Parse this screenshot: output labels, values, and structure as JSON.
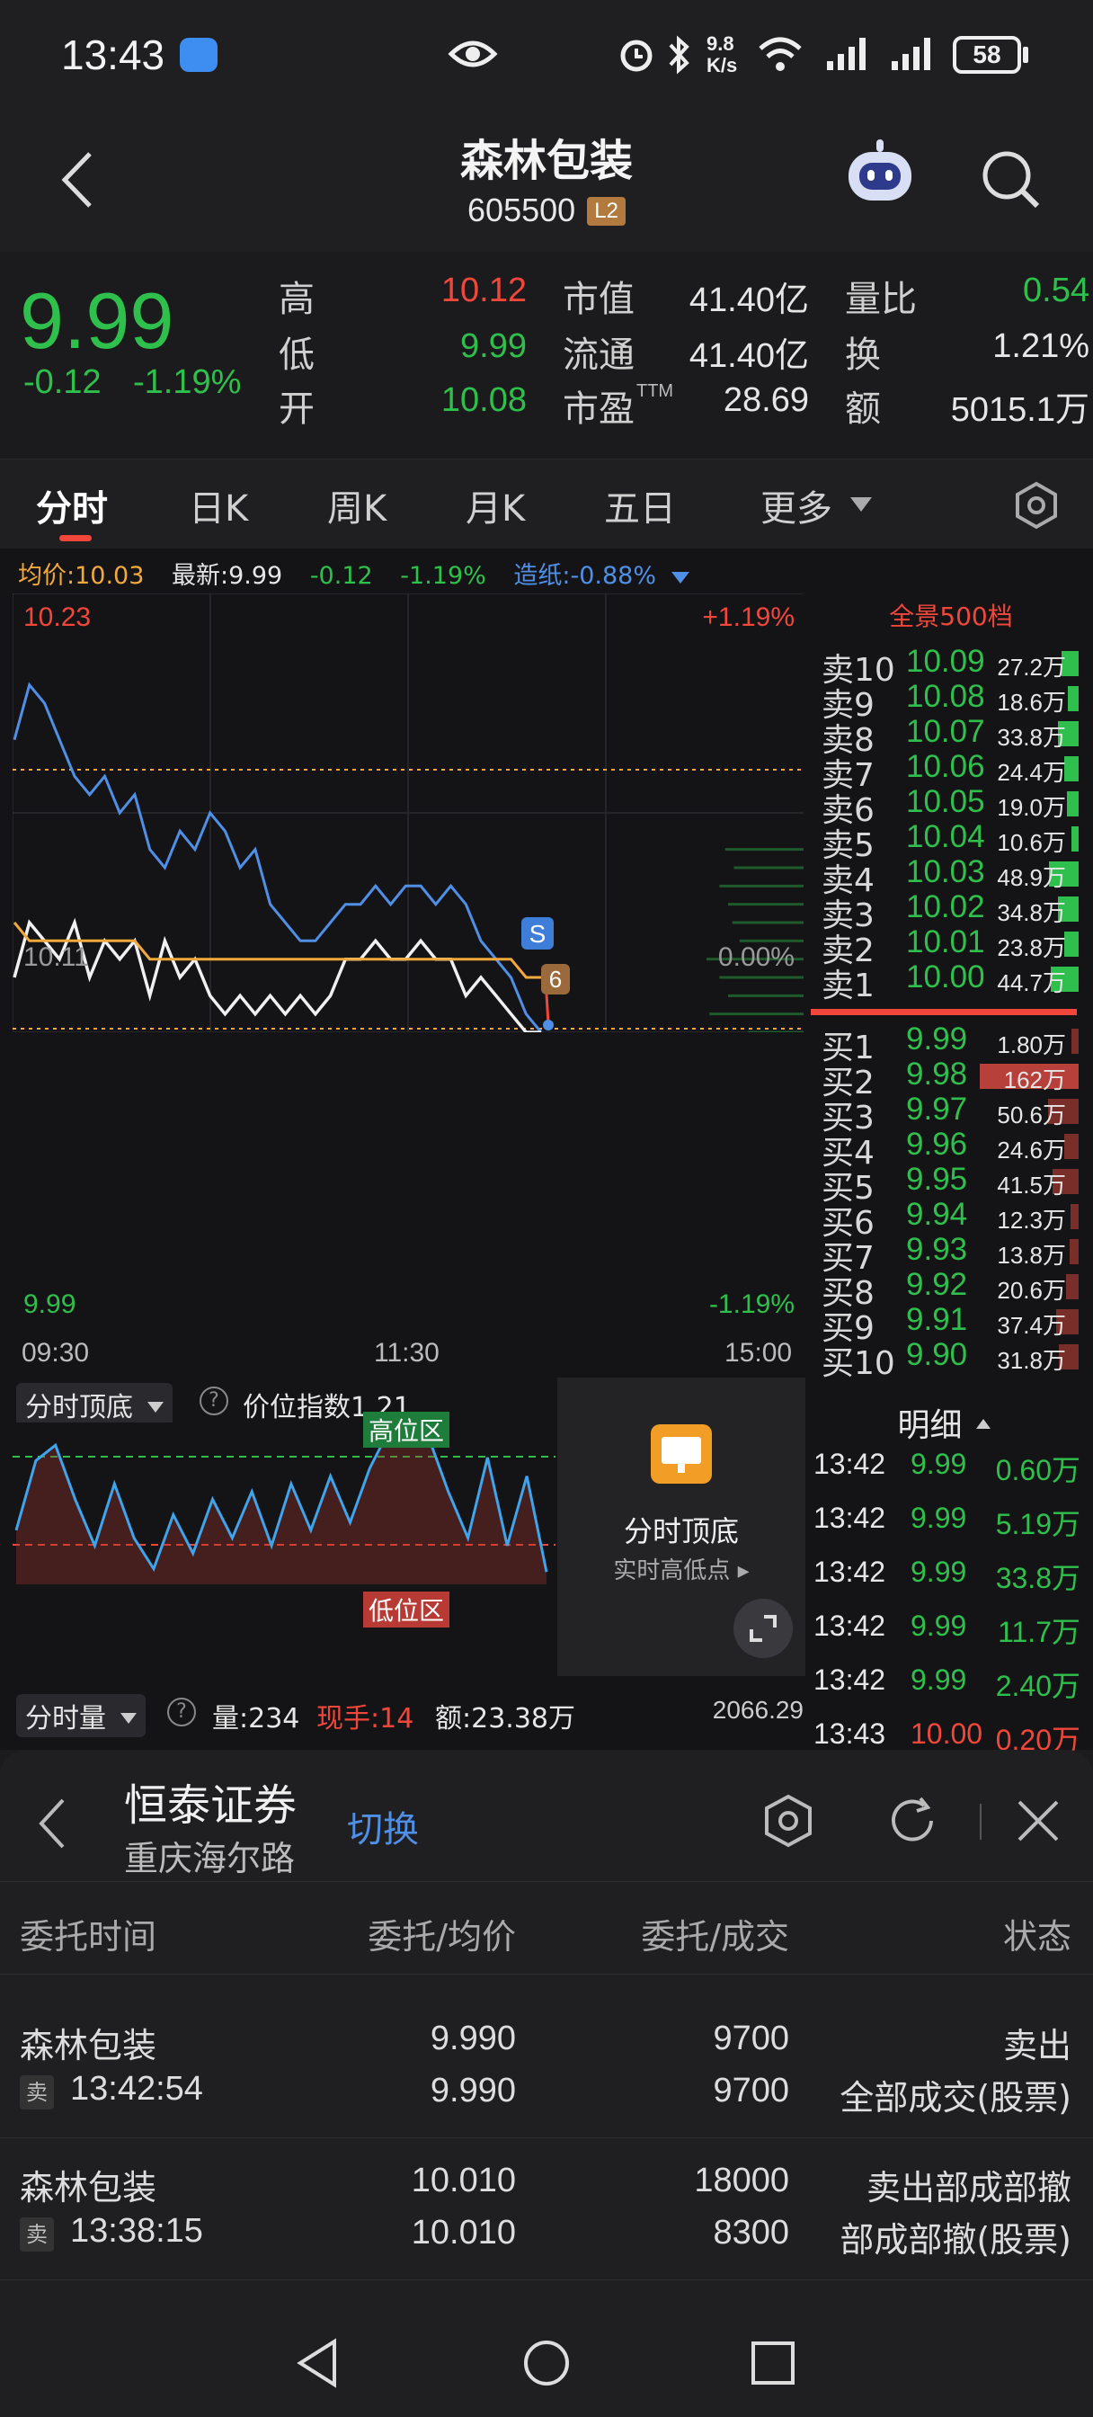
{
  "status": {
    "time": "13:43",
    "net_speed_top": "9.8",
    "net_speed_bottom": "K/s",
    "battery": "58"
  },
  "nav": {
    "title": "森林包装",
    "code": "605500",
    "badge": "L2"
  },
  "quote": {
    "price": "9.99",
    "change": "-0.12",
    "change_pct": "-1.19%",
    "high_label": "高",
    "high": "10.12",
    "low_label": "低",
    "low": "9.99",
    "open_label": "开",
    "open": "10.08",
    "mcap_label": "市值",
    "mcap": "41.40亿",
    "float_label": "流通",
    "float": "41.40亿",
    "pe_label": "市盈",
    "pe_sup": "TTM",
    "pe": "28.69",
    "vr_label": "量比",
    "vr": "0.54",
    "turn_label": "换",
    "turn": "1.21%",
    "amt_label": "额",
    "amt": "5015.1万"
  },
  "tabs": [
    "分时",
    "日K",
    "周K",
    "月K",
    "五日",
    "更多"
  ],
  "chart_info": {
    "avg_label": "均价:10.03",
    "last_label": "最新:9.99",
    "chg": "-0.12",
    "chg_pct": "-1.19%",
    "paper": "造纸:-0.88%"
  },
  "chart_data": {
    "type": "line",
    "y_top": "10.23",
    "y_mid": "10.11",
    "y_bottom": "9.99",
    "pct_top": "+1.19%",
    "pct_mid": "0.00%",
    "pct_bottom": "-1.19%",
    "x_labels": [
      "09:30",
      "11:30",
      "15:00"
    ],
    "ylim": [
      9.99,
      10.23
    ],
    "series": [
      {
        "values": [
          10.15,
          10.18,
          10.17,
          10.15,
          10.13,
          10.12,
          10.13,
          10.11,
          10.12,
          10.09,
          10.08,
          10.1,
          10.09,
          10.11,
          10.1,
          10.08,
          10.09,
          10.06,
          10.05,
          10.04,
          10.04,
          10.05,
          10.06,
          10.06,
          10.07,
          10.06,
          10.07,
          10.07,
          10.06,
          10.07,
          10.06,
          10.04,
          10.03,
          10.02,
          10.0,
          9.99
        ]
      },
      {
        "values": [
          10.02,
          10.05,
          10.04,
          10.03,
          10.05,
          10.02,
          10.04,
          10.03,
          10.04,
          10.01,
          10.04,
          10.02,
          10.03,
          10.01,
          10.0,
          10.01,
          10.0,
          10.01,
          10.0,
          10.01,
          10.0,
          10.01,
          10.03,
          10.03,
          10.04,
          10.03,
          10.03,
          10.04,
          10.03,
          10.03,
          10.01,
          10.02,
          10.01,
          10.0,
          9.99,
          9.99
        ]
      },
      {
        "values": [
          10.05,
          10.04,
          10.04,
          10.04,
          10.04,
          10.04,
          10.04,
          10.04,
          10.04,
          10.03,
          10.03,
          10.03,
          10.03,
          10.03,
          10.03,
          10.03,
          10.03,
          10.03,
          10.03,
          10.03,
          10.03,
          10.03,
          10.03,
          10.03,
          10.03,
          10.03,
          10.03,
          10.03,
          10.03,
          10.03,
          10.03,
          10.03,
          10.03,
          10.03,
          10.02,
          10.02
        ]
      }
    ],
    "markers": {
      "s": "S",
      "b": "6"
    }
  },
  "indicator": {
    "name": "分时顶底",
    "index": "价位指数1.21",
    "high_zone": "高位区",
    "low_zone": "低位区",
    "values": [
      0.35,
      0.8,
      0.9,
      0.55,
      0.25,
      0.65,
      0.3,
      0.1,
      0.45,
      0.2,
      0.55,
      0.3,
      0.6,
      0.25,
      0.65,
      0.35,
      0.7,
      0.4,
      0.75,
      1.0,
      0.92,
      0.95,
      0.6,
      0.3,
      0.82,
      0.25,
      0.7,
      0.08
    ]
  },
  "promo": {
    "title": "分时顶底",
    "subtitle": "实时高低点 ▸"
  },
  "volume_bar": {
    "name": "分时量",
    "vol": "量:234",
    "now_label": "现手:14",
    "amount": "额:23.38万",
    "right": "2066.29"
  },
  "orderbook": {
    "title": "全景500档",
    "sells": [
      {
        "l": "卖10",
        "p": "10.09",
        "v": "27.2万",
        "w": 0.17
      },
      {
        "l": "卖9",
        "p": "10.08",
        "v": "18.6万",
        "w": 0.11
      },
      {
        "l": "卖8",
        "p": "10.07",
        "v": "33.8万",
        "w": 0.21
      },
      {
        "l": "卖7",
        "p": "10.06",
        "v": "24.4万",
        "w": 0.15
      },
      {
        "l": "卖6",
        "p": "10.05",
        "v": "19.0万",
        "w": 0.12
      },
      {
        "l": "卖5",
        "p": "10.04",
        "v": "10.6万",
        "w": 0.07
      },
      {
        "l": "卖4",
        "p": "10.03",
        "v": "48.9万",
        "w": 0.3
      },
      {
        "l": "卖3",
        "p": "10.02",
        "v": "34.8万",
        "w": 0.21
      },
      {
        "l": "卖2",
        "p": "10.01",
        "v": "23.8万",
        "w": 0.15
      },
      {
        "l": "卖1",
        "p": "10.00",
        "v": "44.7万",
        "w": 0.28
      }
    ],
    "buys": [
      {
        "l": "买1",
        "p": "9.99",
        "v": "1.80万",
        "w": 0.01
      },
      {
        "l": "买2",
        "p": "9.98",
        "v": "162万",
        "w": 1.0
      },
      {
        "l": "买3",
        "p": "9.97",
        "v": "50.6万",
        "w": 0.31
      },
      {
        "l": "买4",
        "p": "9.96",
        "v": "24.6万",
        "w": 0.15
      },
      {
        "l": "买5",
        "p": "9.95",
        "v": "41.5万",
        "w": 0.26
      },
      {
        "l": "买6",
        "p": "9.94",
        "v": "12.3万",
        "w": 0.08
      },
      {
        "l": "买7",
        "p": "9.93",
        "v": "13.8万",
        "w": 0.09
      },
      {
        "l": "买8",
        "p": "9.92",
        "v": "20.6万",
        "w": 0.13
      },
      {
        "l": "买9",
        "p": "9.91",
        "v": "37.4万",
        "w": 0.23
      },
      {
        "l": "买10",
        "p": "9.90",
        "v": "31.8万",
        "w": 0.2
      }
    ]
  },
  "ticks": {
    "title": "明细",
    "rows": [
      {
        "t": "13:42",
        "p": "9.99",
        "v": "0.60万",
        "c": "green"
      },
      {
        "t": "13:42",
        "p": "9.99",
        "v": "5.19万",
        "c": "green"
      },
      {
        "t": "13:42",
        "p": "9.99",
        "v": "33.8万",
        "c": "green"
      },
      {
        "t": "13:42",
        "p": "9.99",
        "v": "11.7万",
        "c": "green"
      },
      {
        "t": "13:42",
        "p": "9.99",
        "v": "2.40万",
        "c": "green"
      },
      {
        "t": "13:43",
        "p": "10.00",
        "v": "0.20万",
        "c": "red"
      }
    ]
  },
  "broker": {
    "name": "恒泰证券",
    "branch": "重庆海尔路",
    "switch": "切换",
    "cols": [
      "委托时间",
      "委托/均价",
      "委托/成交",
      "状态"
    ],
    "orders": [
      {
        "stock": "森林包装",
        "side": "卖",
        "time": "13:42:54",
        "price": "9.990",
        "avg": "9.990",
        "qty": "9700",
        "filled": "9700",
        "status1": "卖出",
        "status2": "全部成交(股票)"
      },
      {
        "stock": "森林包装",
        "side": "卖",
        "time": "13:38:15",
        "price": "10.010",
        "avg": "10.010",
        "qty": "18000",
        "filled": "8300",
        "status1": "卖出部成部撤",
        "status2": "部成部撤(股票)"
      }
    ]
  },
  "colors": {
    "up": "#f0473a",
    "down": "#2fbf4c",
    "avg": "#f2a93b",
    "line": "#4f8fe6"
  }
}
